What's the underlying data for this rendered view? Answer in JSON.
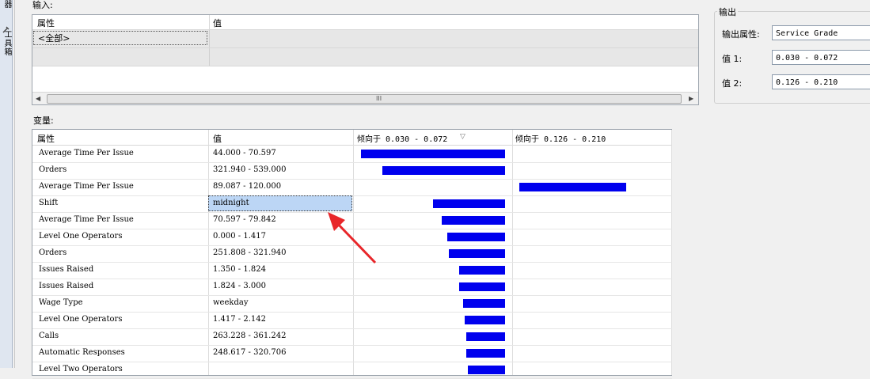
{
  "sidebar": {
    "tab1": "器",
    "tab2": "工具箱"
  },
  "input": {
    "label": "输入:",
    "col_attr": "属性",
    "col_value": "值",
    "all_row": "<全部>",
    "scroll_grip": "III"
  },
  "output": {
    "title": "输出",
    "attr_label": "输出属性:",
    "attr_value": "Service Grade",
    "value1_label": "值 1:",
    "value1": "0.030 - 0.072",
    "value2_label": "值 2:",
    "value2": "0.126 - 0.210"
  },
  "variables": {
    "label": "变量:",
    "col_attr": "属性",
    "col_value": "值",
    "col_fav1": "倾向于 0.030 - 0.072",
    "col_fav2": "倾向于 0.126 - 0.210",
    "rows": [
      {
        "attr": "Average Time Per Issue",
        "value": "44.000 - 70.597",
        "fav1": 1.0,
        "fav2": 0
      },
      {
        "attr": "Orders",
        "value": "321.940 - 539.000",
        "fav1": 0.85,
        "fav2": 0
      },
      {
        "attr": "Average Time Per Issue",
        "value": "89.087 - 120.000",
        "fav1": 0,
        "fav2": 1.0
      },
      {
        "attr": "Shift",
        "value": "midnight",
        "fav1": 0.5,
        "fav2": 0
      },
      {
        "attr": "Average Time Per Issue",
        "value": "70.597 - 79.842",
        "fav1": 0.44,
        "fav2": 0
      },
      {
        "attr": "Level One Operators",
        "value": "0.000 - 1.417",
        "fav1": 0.4,
        "fav2": 0
      },
      {
        "attr": "Orders",
        "value": "251.808 - 321.940",
        "fav1": 0.39,
        "fav2": 0
      },
      {
        "attr": "Issues Raised",
        "value": "1.350 - 1.824",
        "fav1": 0.32,
        "fav2": 0
      },
      {
        "attr": "Issues Raised",
        "value": "1.824 - 3.000",
        "fav1": 0.32,
        "fav2": 0
      },
      {
        "attr": "Wage Type",
        "value": "weekday",
        "fav1": 0.29,
        "fav2": 0
      },
      {
        "attr": "Level One Operators",
        "value": "1.417 - 2.142",
        "fav1": 0.28,
        "fav2": 0
      },
      {
        "attr": "Calls",
        "value": "263.228 - 361.242",
        "fav1": 0.27,
        "fav2": 0
      },
      {
        "attr": "Automatic Responses",
        "value": "248.617 - 320.706",
        "fav1": 0.27,
        "fav2": 0
      },
      {
        "attr": "Level Two Operators",
        "value": "",
        "fav1": 0.26,
        "fav2": 0
      }
    ],
    "selected_row": 3
  },
  "colors": {
    "bar": "#0000ee",
    "arrow": "#e8262a",
    "selection": "#bcd6f5"
  }
}
